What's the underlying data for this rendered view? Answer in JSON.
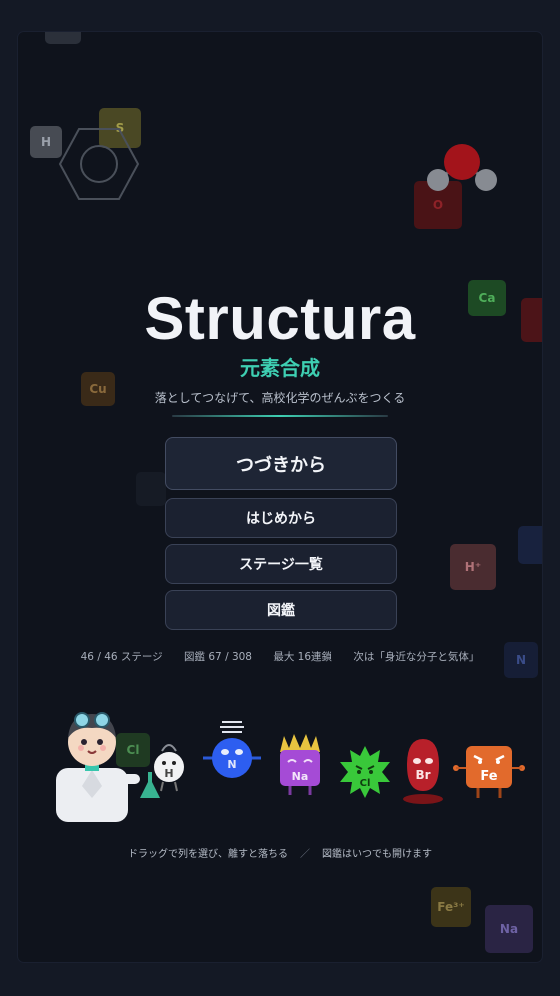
{
  "app": {
    "title": "Structura",
    "subtitle": "元素合成",
    "tagline": "落としてつなげて、高校化学のぜんぶをつくる"
  },
  "menu": {
    "continue_label": "つづきから",
    "new_game_label": "はじめから",
    "stage_list_label": "ステージ一覧",
    "encyclopedia_label": "図鑑"
  },
  "stats": {
    "stages": "46 / 46 ステージ",
    "encyclopedia": "図鑑 67 / 308",
    "max_chain": "最大 16連鎖",
    "next": "次は「身近な分子と気体」"
  },
  "hint": {
    "drag": "ドラッグで列を選び、離すと落ちる",
    "separator": "／",
    "encyclopedia": "図鑑はいつでも開けます"
  },
  "background_tiles": {
    "h": "H",
    "s": "S",
    "o": "O",
    "ca": "Ca",
    "cu": "Cu",
    "h_plus": "H⁺",
    "n": "N",
    "cl": "Cl",
    "fe3": "Fe³⁺",
    "na": "Na"
  },
  "characters": {
    "h": "H",
    "n": "N",
    "na": "Na",
    "cl": "Cl",
    "br": "Br",
    "fe": "Fe"
  },
  "colors": {
    "accent": "#3ecfb2",
    "button_bg": "#1b2130",
    "button_border": "#3a4256",
    "background": "#0f131c"
  }
}
